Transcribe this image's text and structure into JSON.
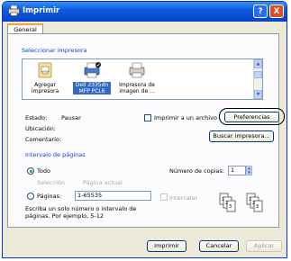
{
  "window": {
    "title": "Imprimir",
    "help_button": "?",
    "close_button": "X"
  },
  "tabs": [
    {
      "label": "General"
    }
  ],
  "printer_selection": {
    "section_title": "Seleccionar impresora",
    "printers": [
      {
        "label": "Agregar impresora",
        "icon": "add-printer-icon"
      },
      {
        "label": "Dell 2335dn MFP PCL6",
        "icon": "printer-icon",
        "selected": true
      },
      {
        "label": "Impresora de imagen de ...",
        "icon": "image-printer-icon"
      }
    ]
  },
  "status": {
    "estado_label": "Estado:",
    "estado_value": "Pausar",
    "ubicacion_label": "Ubicación:",
    "comentario_label": "Comentario:",
    "print_to_file_label": "Imprimir a un archivo",
    "preferences_button": "Preferencias",
    "find_printer_button": "Buscar impresora..."
  },
  "page_range": {
    "section_title": "Intervalo de páginas",
    "all_label": "Todo",
    "selection_label": "Selección",
    "current_page_label": "Página actual",
    "pages_label": "Páginas:",
    "pages_value": "1-65535",
    "hint": "Escriba un solo número o intervalo de páginas. Por ejemplo, 5-12"
  },
  "copies": {
    "label": "Número de copias:",
    "value": "1",
    "collate_label": "Intercalar"
  },
  "footer": {
    "print_button": "Imprimir",
    "cancel_button": "Cancelar",
    "apply_button": "Aplicar"
  },
  "colors": {
    "title_bar": "#0a5ce0",
    "section_title": "#0046d5",
    "selection": "#316ac5"
  }
}
